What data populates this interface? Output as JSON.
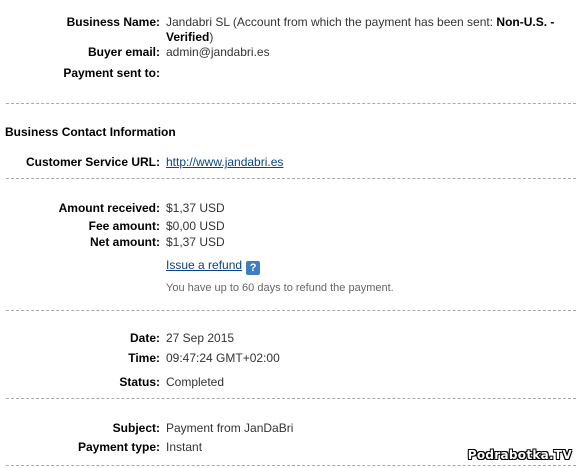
{
  "business": {
    "name_label": "Business Name:",
    "name_value": "Jandabri SL (Account from which the payment has been sent: ",
    "name_status": "Non-U.S. - Verified",
    "name_close": ")",
    "buyer_email_label": "Buyer email:",
    "buyer_email_value": "admin@jandabri.es",
    "sent_to_label": "Payment sent to:",
    "sent_to_value": ""
  },
  "contact": {
    "section_title": "Business Contact Information",
    "customer_service_label": "Customer Service URL:",
    "customer_service_url": "http://www.jandabri.es"
  },
  "amounts": {
    "received_label": "Amount received:",
    "received_value": "$1,37 USD",
    "fee_label": "Fee amount:",
    "fee_value": "$0,00 USD",
    "net_label": "Net amount:",
    "net_value": "$1,37 USD",
    "refund_link": "Issue a refund",
    "help_icon_text": "?",
    "refund_note": "You have up to 60 days to refund the payment."
  },
  "timing": {
    "date_label": "Date:",
    "date_value": "27 Sep 2015",
    "time_label": "Time:",
    "time_value": "09:47:24 GMT+02:00",
    "status_label": "Status:",
    "status_value": "Completed"
  },
  "payment": {
    "subject_label": "Subject:",
    "subject_value": "Payment from JanDaBri",
    "type_label": "Payment type:",
    "type_value": "Instant"
  },
  "watermark": "Podrabotka.TV",
  "colors": {
    "link": "#084482",
    "separator": "#a9a9a9",
    "help_icon": "#3e7fc1"
  }
}
